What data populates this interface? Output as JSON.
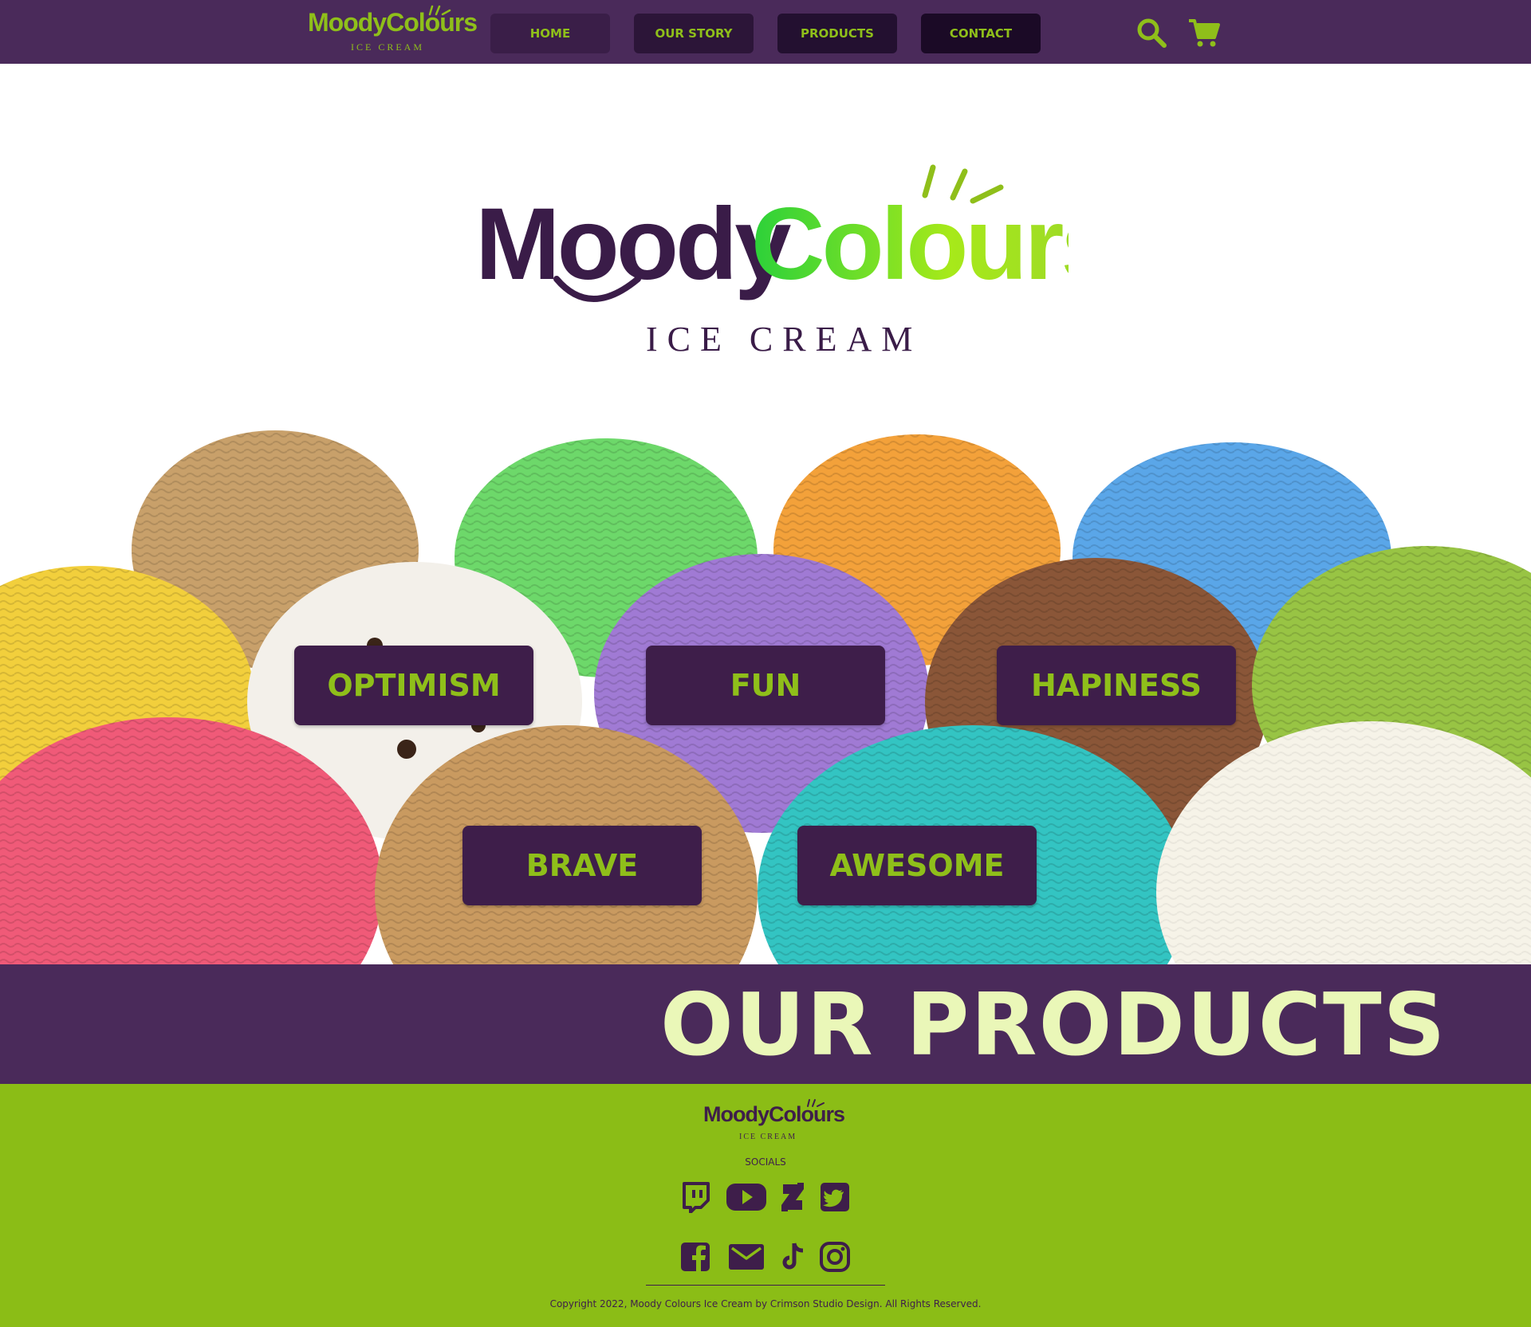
{
  "header": {
    "brand": {
      "word_dark": "Moody",
      "word_light": "Colours",
      "tagline": "ICE CREAM"
    },
    "nav": [
      {
        "label": "HOME"
      },
      {
        "label": "OUR STORY"
      },
      {
        "label": "PRODUCTS"
      },
      {
        "label": "CONTACT"
      }
    ],
    "icons": [
      "search-icon",
      "cart-icon"
    ]
  },
  "hero": {
    "brand": {
      "word_dark": "Moody",
      "word_light": "Colours",
      "tagline": "ICE CREAM"
    }
  },
  "moods": [
    {
      "label": "OPTIMISM"
    },
    {
      "label": "FUN"
    },
    {
      "label": "HAPINESS"
    },
    {
      "label": "BRAVE"
    },
    {
      "label": "AWESOME"
    }
  ],
  "products": {
    "title": "OUR PRODUCTS"
  },
  "footer": {
    "brand": {
      "word_dark": "Moody",
      "word_light": "Colours",
      "tagline": "ICE CREAM"
    },
    "socials_label": "SOCIALS",
    "socials": [
      "twitch-icon",
      "youtube-icon",
      "deviantart-icon",
      "twitter-icon",
      "facebook-icon",
      "mail-icon",
      "tiktok-icon",
      "instagram-icon"
    ],
    "copyright": "Copyright 2022, Moody Colours Ice Cream by Crimson Studio Design. All Rights Reserved."
  },
  "colors": {
    "purple": "#4a2a5a",
    "dark_purple": "#3e1e4a",
    "lime": "#8fbf1a",
    "footer_green": "#8bbd16",
    "pale_lime": "#eaf7b8"
  }
}
